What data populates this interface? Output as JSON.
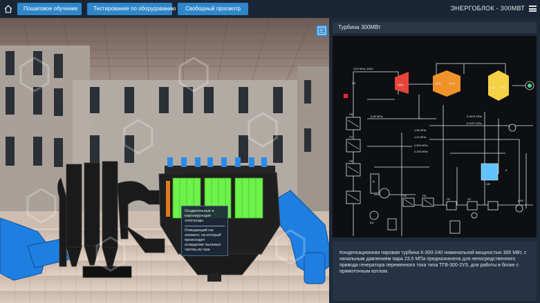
{
  "nav": {
    "buttons": [
      {
        "label": "Пошаговое обучение"
      },
      {
        "label": "Тестирование по оборудованию"
      },
      {
        "label": "Свободный просмотр"
      }
    ],
    "app_title": "ЭНЕРГОБЛОК - 300МВТ"
  },
  "tooltip": {
    "line1": "Осадительные и коронирующие электроды",
    "line2": "Очищающий газ элемент, на который происходит осаждение пылевых частиц из газа"
  },
  "panel": {
    "title": "Турбина 300МВт",
    "description": "Конденсационная паровая турбина К-300-240 номинальной мощностью 300 МВт, с начальным давлением пара 23,5 МПа предназначена для непосредственного привода генератора переменного тока типа ТГВ-300-2УЗ, для работы в блоке с прямоточным котлом."
  },
  "scheme": {
    "cylinders": [
      "ЦВД",
      "ЦСД",
      "ЦСД",
      "ЦНД",
      "ЦНД"
    ],
    "labels": {
      "steam": "23,5 МПа, 540С",
      "pk": "ПК",
      "p8": "П8",
      "p7": "П7",
      "p6": "П6",
      "p4": "П4",
      "p3": "П3",
      "p2": "П2",
      "p1": "П1",
      "d": "Д",
      "bn": "БН",
      "mpa1": "6,05 МПа",
      "mpa2": "1,58 МПа",
      "mpa3": "1,04 МПа",
      "mpa4": "0,504 МПа",
      "mpa5": "0,235 МПа",
      "mpa6": "0,0876 МПа",
      "mpa7": "0,0157 МПа",
      "k": "К",
      "ov": "ОВ",
      "dns": "ДНС"
    }
  }
}
